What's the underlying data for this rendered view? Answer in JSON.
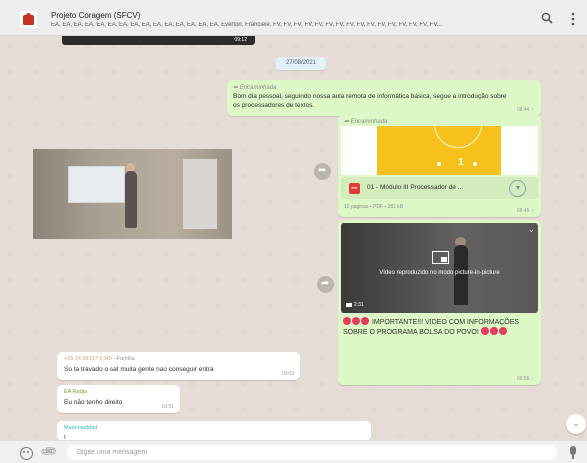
{
  "header": {
    "group_name": "Projeto Coragem (SFCV)",
    "participants": "EA, EA, EA, EA, EA, EA, EA, EA, EA, EA, EA, EA, EA, EA, EA, Everton, Franciele, FV, FV, FV, FV, FV, FV, FV, FV, FV, FV, FV, FV, FV, FV, FV, FV...",
    "search_icon": "search-icon",
    "menu_icon": "kebab-menu-icon"
  },
  "top_video": {
    "time": "09:12"
  },
  "date_separator": "27/08/2021",
  "messages": {
    "m1": {
      "forwarded_label": "Encaminhada",
      "text": "Bom dia pessoal, seguindo nossa aula remota de informática básica, segue a introdução sobre os processadores de textos.",
      "time": "08:44"
    },
    "m2": {
      "forwarded_label": "Encaminhada",
      "file_name": "01 - Módulo III Processador de ...",
      "pdf_badge": "PDF",
      "meta": "12 páginas • PDF • 282 kB",
      "time": "08:45"
    },
    "m3": {
      "video_overlay": "Vídeo reproduzido no modo picture-in-picture",
      "duration": "2:31",
      "text": "IMPORTANTE!!! VIDEO COM INFORMAÇÕES SOBRE O PROGRAMA BOLSA DO POVO!",
      "time": "09:58"
    },
    "m4": {
      "sender": "+55 14 98137-5740",
      "sender_name": "~Família",
      "text": "So ta travado o sat muita gente nao conseguir entra",
      "time": "10:03"
    },
    "m5": {
      "sender": "EA Radja",
      "text": "Eu não tenho direito",
      "time": "10:51"
    },
    "m6": {
      "sender": "Mara Haddad",
      "text": "I"
    }
  },
  "composer": {
    "placeholder": "Digite uma mensagem"
  },
  "colors": {
    "outgoing_bubble": "#dcf8c6",
    "incoming_bubble": "#ffffff",
    "chat_background": "#e5ddd5",
    "header_background": "#ededed"
  }
}
